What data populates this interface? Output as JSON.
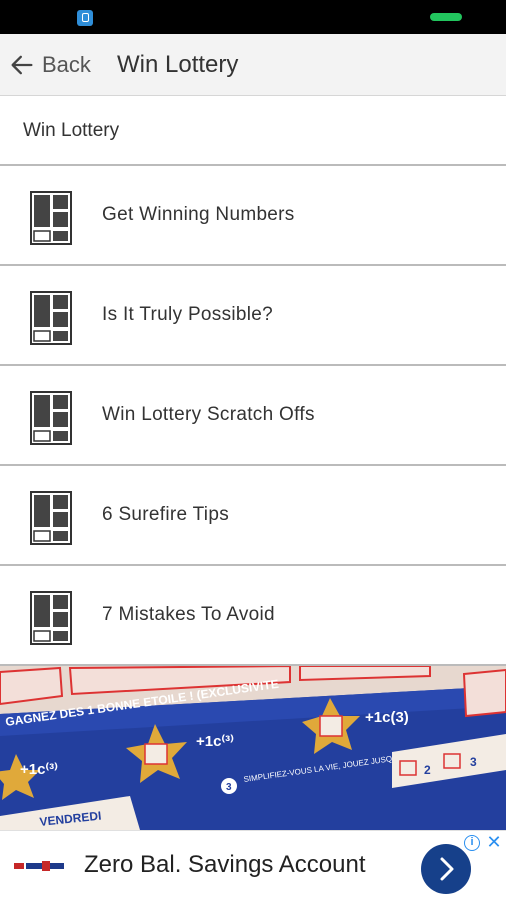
{
  "status_bar": {
    "app_icon": "app-notification-icon",
    "battery_color": "#22c55e"
  },
  "app_bar": {
    "back_label": "Back",
    "title": "Win Lottery"
  },
  "section": {
    "title": "Win Lottery"
  },
  "list": {
    "items": [
      {
        "label": "Get Winning Numbers",
        "icon": "article-icon"
      },
      {
        "label": "Is It Truly Possible?",
        "icon": "article-icon"
      },
      {
        "label": "Win Lottery Scratch Offs",
        "icon": "article-icon"
      },
      {
        "label": "6 Surefire Tips",
        "icon": "article-icon"
      },
      {
        "label": "7 Mistakes To Avoid",
        "icon": "article-icon"
      }
    ]
  },
  "banner": {
    "image": "lottery-scratch-ticket-photo",
    "texts": [
      "GAGNEZ DES 1 BONNE ETOILE ! (EXCLUSIVITE",
      "SIMPLIFIEZ-VOUS LA VIE, JOUEZ JUSQU'À 5 SEMAINES !",
      "VENDREDI",
      "+1c(3)"
    ]
  },
  "ad": {
    "text": "Zero Bal. Savings Account",
    "cta_icon": "chevron-right-icon",
    "info_icon": "info-icon",
    "close_icon": "close-icon",
    "accent": "#16408a"
  }
}
